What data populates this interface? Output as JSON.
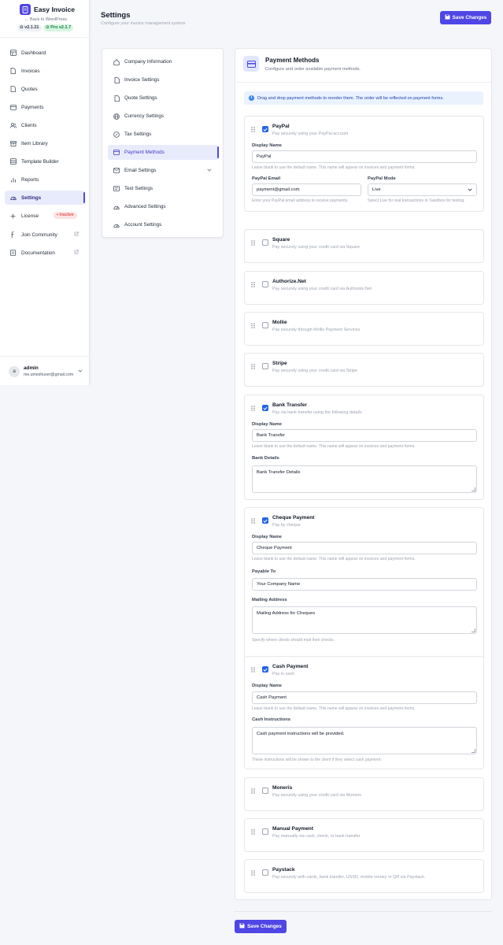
{
  "app": {
    "name": "Easy Invoice",
    "back_link": "← Back to WordPress",
    "version": "v2.1.21",
    "pro_version": "Pro v2.1.7"
  },
  "sidebar": {
    "items": [
      {
        "label": "Dashboard",
        "icon": "dashboard-icon"
      },
      {
        "label": "Invoices",
        "icon": "file-icon"
      },
      {
        "label": "Quotes",
        "icon": "file-icon"
      },
      {
        "label": "Payments",
        "icon": "credit-card-icon"
      },
      {
        "label": "Clients",
        "icon": "users-icon"
      },
      {
        "label": "Item Library",
        "icon": "box-icon"
      },
      {
        "label": "Template Builder",
        "icon": "layout-icon"
      },
      {
        "label": "Reports",
        "icon": "bar-chart-icon"
      },
      {
        "label": "Settings",
        "icon": "gauge-icon"
      },
      {
        "label": "License",
        "icon": "plus-icon",
        "badge": "• Inactive"
      },
      {
        "label": "Join Community",
        "icon": "facebook-icon"
      },
      {
        "label": "Documentation",
        "icon": "document-icon"
      }
    ],
    "user": {
      "initial": "a",
      "name": "admin",
      "email": "me.umeshuser@gmail.com"
    }
  },
  "header": {
    "title": "Settings",
    "subtitle": "Configure your invoice management system",
    "save_label": "Save Changes"
  },
  "settings_menu": [
    {
      "label": "Company Information",
      "icon": "home-icon"
    },
    {
      "label": "Invoice Settings",
      "icon": "file-icon"
    },
    {
      "label": "Quote Settings",
      "icon": "file-icon"
    },
    {
      "label": "Currency Settings",
      "icon": "globe-icon"
    },
    {
      "label": "Tax Settings",
      "icon": "percent-icon"
    },
    {
      "label": "Payment Methods",
      "icon": "credit-card-icon"
    },
    {
      "label": "Email Settings",
      "icon": "mail-icon"
    },
    {
      "label": "Text Settings",
      "icon": "text-icon"
    },
    {
      "label": "Advanced Settings",
      "icon": "gauge-icon"
    },
    {
      "label": "Account Settings",
      "icon": "gauge-icon"
    }
  ],
  "panel": {
    "title": "Payment Methods",
    "subtitle": "Configure and order available payment methods.",
    "info": "Drag and drop payment methods to reorder them. The order will be reflected on payment forms."
  },
  "common": {
    "display_name_label": "Display Name",
    "display_name_help": "Leave blank to use the default name. This name will appear on invoices and payment forms."
  },
  "methods": {
    "paypal": {
      "name": "PayPal",
      "desc": "Pay securely using your PayPal account",
      "enabled": true,
      "display_name": "PayPal",
      "email_label": "PayPal Email",
      "email": "payment@gmail.com",
      "email_help": "Enter your PayPal email address to receive payments.",
      "mode_label": "PayPal Mode",
      "mode": "Live",
      "mode_help": "Select Live for real transactions or Sandbox for testing."
    },
    "square": {
      "name": "Square",
      "desc": "Pay securely using your credit card via Square",
      "enabled": false
    },
    "authorize": {
      "name": "Authorize.Net",
      "desc": "Pay securely using your credit card via Authorize.Net",
      "enabled": false
    },
    "mollie": {
      "name": "Mollie",
      "desc": "Pay securely through Mollie Payment Services",
      "enabled": false
    },
    "stripe": {
      "name": "Stripe",
      "desc": "Pay securely using your credit card via Stripe",
      "enabled": false
    },
    "bank": {
      "name": "Bank Transfer",
      "desc": "Pay via bank transfer using the following details",
      "enabled": true,
      "display_name": "Bank Transfer",
      "details_label": "Bank Details",
      "details": "Bank Transfer Details"
    },
    "cheque": {
      "name": "Cheque Payment",
      "desc": "Pay by cheque",
      "enabled": true,
      "display_name": "Cheque Payment",
      "payable_label": "Payable To",
      "payable": "Your Company Name",
      "mailing_label": "Mailing Address",
      "mailing": "Mailing Address for Cheques",
      "mailing_help": "Specify where clients should mail their checks."
    },
    "cash": {
      "name": "Cash Payment",
      "desc": "Pay in cash",
      "enabled": true,
      "display_name": "Cash Payment",
      "instructions_label": "Cash Instructions",
      "instructions": "Cash payment instructions will be provided.",
      "instructions_help": "These instructions will be shown to the client if they select cash payment."
    },
    "moneris": {
      "name": "Moneris",
      "desc": "Pay securely using your credit card via Moneris",
      "enabled": false
    },
    "manual": {
      "name": "Manual Payment",
      "desc": "Pay manually via cash, check, or bank transfer",
      "enabled": false
    },
    "paystack": {
      "name": "Paystack",
      "desc": "Pay securely with cards, bank transfer, USSD, mobile money or QR via Paystack.",
      "enabled": false
    }
  },
  "colors": {
    "accent": "#4f46e5",
    "active_bg": "#e8ebfb",
    "checkbox_on": "#2563eb",
    "info_bg": "#eaf2fe",
    "inactive": "#dc2626"
  }
}
